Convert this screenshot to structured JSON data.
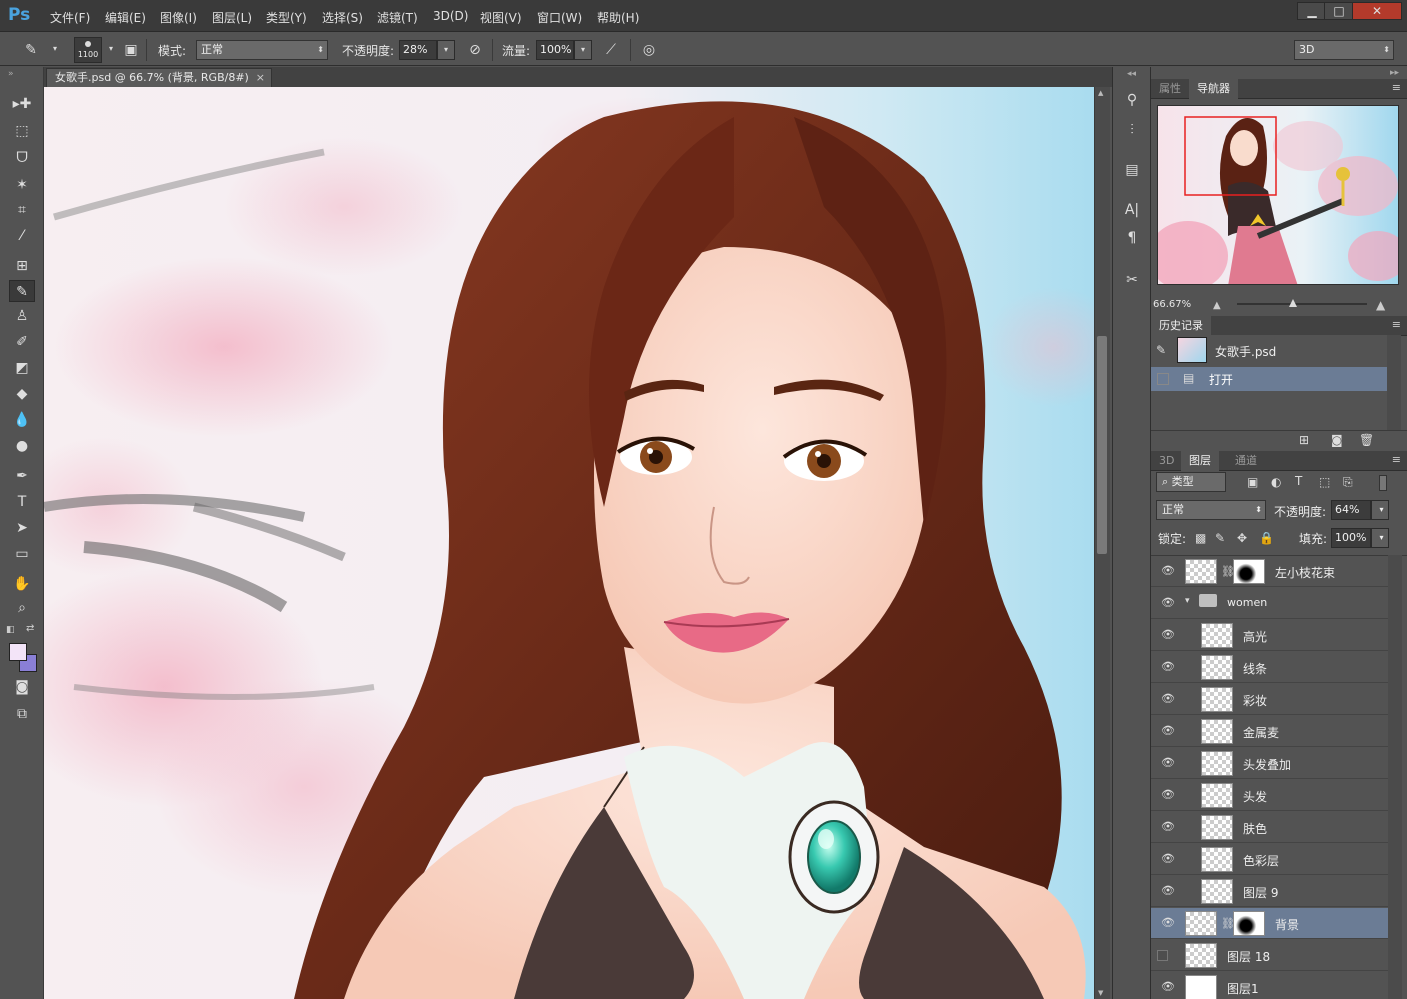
{
  "app": {
    "logo": "Ps"
  },
  "menu": [
    "文件(F)",
    "编辑(E)",
    "图像(I)",
    "图层(L)",
    "类型(Y)",
    "选择(S)",
    "滤镜(T)",
    "3D(D)",
    "视图(V)",
    "窗口(W)",
    "帮助(H)"
  ],
  "window_controls": {
    "minimize": "▁",
    "maximize": "□",
    "close": "✕"
  },
  "options": {
    "brush_size": "1100",
    "mode_label": "模式:",
    "mode_value": "正常",
    "opacity_label": "不透明度:",
    "opacity_value": "28%",
    "flow_label": "流量:",
    "flow_value": "100%",
    "workspace": "3D"
  },
  "document": {
    "tab_title": "女歌手.psd @ 66.7% (背景, RGB/8#)",
    "close": "×"
  },
  "tools": [
    "move-tool",
    "marquee-tool",
    "lasso-tool",
    "magic-wand-tool",
    "crop-tool",
    "eyedropper-tool",
    "healing-brush-tool",
    "brush-tool",
    "clone-stamp-tool",
    "history-brush-tool",
    "eraser-tool",
    "paint-bucket-tool",
    "blur-tool",
    "dodge-tool",
    "pen-tool",
    "type-tool",
    "path-selection-tool",
    "shape-tool",
    "hand-tool",
    "zoom-tool"
  ],
  "tool_glyphs": [
    "▸✚",
    "⬚",
    "ᗜ",
    "✶",
    "⌗",
    "⁄",
    "⊞",
    "✎",
    "♙",
    "✐",
    "◩",
    "◆",
    "💧",
    "●",
    "✒",
    "T",
    "➤",
    "▭",
    "✋",
    "⌕"
  ],
  "colors": {
    "foreground": "#f3e4f8",
    "background": "#8a7fd6",
    "selected_layer": "#6b7c95",
    "history_selected": "#6b7c95"
  },
  "navigator": {
    "tabs": [
      "属性",
      "导航器"
    ],
    "active_tab": "导航器",
    "zoom": "66.67%"
  },
  "history": {
    "tab": "历史记录",
    "snapshot_name": "女歌手.psd",
    "items": [
      "打开"
    ]
  },
  "layers_panel": {
    "tabs": [
      "3D",
      "图层",
      "通道"
    ],
    "active_tab": "图层",
    "filter_kind": "类型",
    "blend_mode": "正常",
    "opacity_label": "不透明度:",
    "opacity": "64%",
    "lock_label": "锁定:",
    "fill_label": "填充:",
    "fill": "100%",
    "layers": [
      {
        "name": "左小枝花束",
        "visible": true,
        "mask": true,
        "indent": 0,
        "selected": false
      },
      {
        "name": "women",
        "visible": true,
        "group": true,
        "indent": 0,
        "selected": false
      },
      {
        "name": "高光",
        "visible": true,
        "indent": 1,
        "selected": false
      },
      {
        "name": "线条",
        "visible": true,
        "indent": 1,
        "selected": false
      },
      {
        "name": "彩妆",
        "visible": true,
        "indent": 1,
        "selected": false
      },
      {
        "name": "金属麦",
        "visible": true,
        "indent": 1,
        "selected": false
      },
      {
        "name": "头发叠加",
        "visible": true,
        "indent": 1,
        "selected": false
      },
      {
        "name": "头发",
        "visible": true,
        "indent": 1,
        "selected": false
      },
      {
        "name": "肤色",
        "visible": true,
        "indent": 1,
        "selected": false
      },
      {
        "name": "色彩层",
        "visible": true,
        "indent": 1,
        "selected": false
      },
      {
        "name": "图层 9",
        "visible": true,
        "indent": 1,
        "selected": false
      },
      {
        "name": "背景",
        "visible": true,
        "mask": true,
        "indent": 0,
        "selected": true
      },
      {
        "name": "图层 18",
        "visible": false,
        "indent": 0,
        "selected": false
      },
      {
        "name": "图层1",
        "visible": true,
        "indent": 0,
        "selected": false
      }
    ]
  }
}
